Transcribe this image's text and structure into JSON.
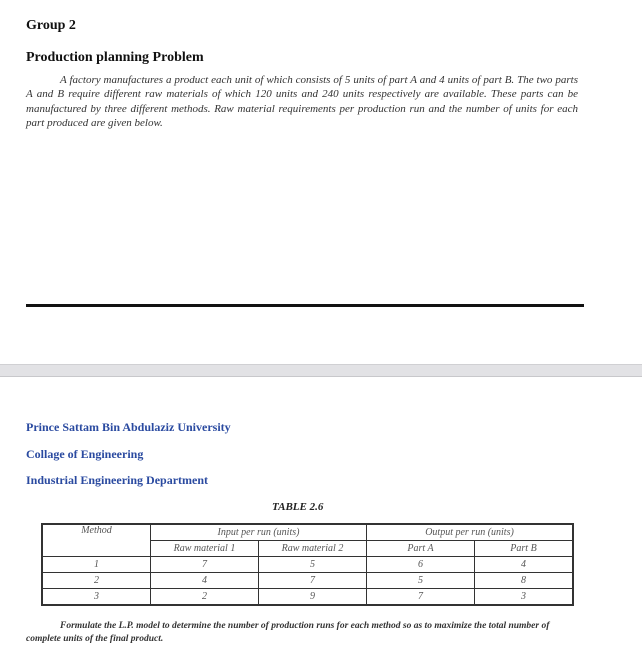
{
  "header": {
    "group": "Group 2",
    "title": "Production planning Problem"
  },
  "problem_text": "A factory manufactures a product each unit of which consists of 5 units of part A and 4 units of part B. The two parts A and B require different raw materials of which 120 units and 240 units respectively are available. These parts can be manufactured by three different methods. Raw material requirements per production run and the number of units for each part produced are given below.",
  "institution": {
    "university": "Prince Sattam Bin Abdulaziz University",
    "college": "Collage of Engineering",
    "department": "Industrial Engineering Department"
  },
  "table": {
    "caption": "TABLE 2.6",
    "headers": {
      "method": "Method",
      "input_group": "Input per run (units)",
      "output_group": "Output per run (units)",
      "raw1": "Raw material 1",
      "raw2": "Raw material 2",
      "partA": "Part A",
      "partB": "Part B"
    },
    "rows": [
      {
        "method": "1",
        "raw1": "7",
        "raw2": "5",
        "partA": "6",
        "partB": "4"
      },
      {
        "method": "2",
        "raw1": "4",
        "raw2": "7",
        "partA": "5",
        "partB": "8"
      },
      {
        "method": "3",
        "raw1": "2",
        "raw2": "9",
        "partA": "7",
        "partB": "3"
      }
    ]
  },
  "footer_text": "Formulate the L.P. model to determine the number of production runs for each method so as to maximize the total number of complete units of the final product.",
  "colors": {
    "institution_blue": "#2a4aa0"
  }
}
